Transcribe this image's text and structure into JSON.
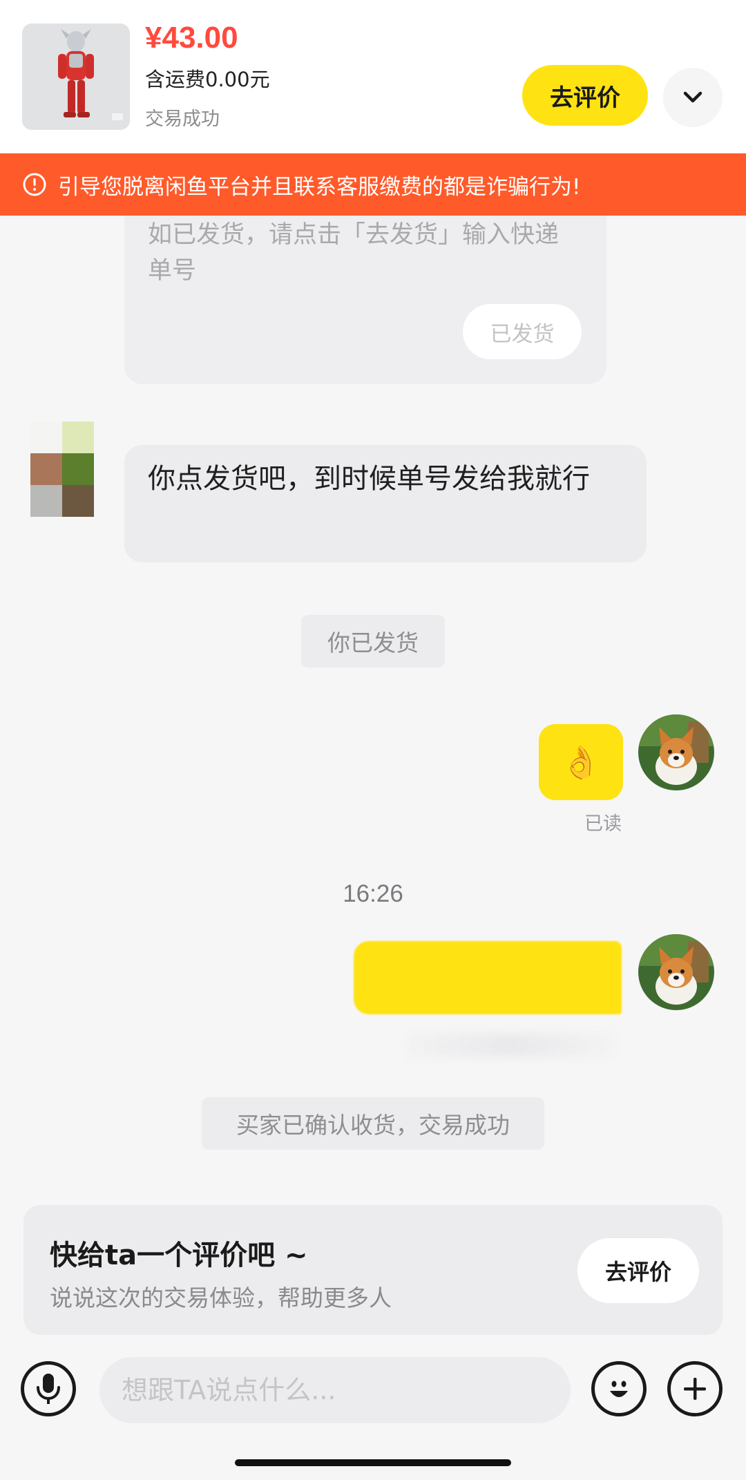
{
  "header": {
    "price": "¥43.00",
    "shipping": "含运费0.00元",
    "status": "交易成功",
    "review_button": "去评价"
  },
  "warning": {
    "text": "引导您脱离闲鱼平台并且联系客服缴费的都是诈骗行为!"
  },
  "chat": {
    "card_text": "如已发货，请点击「去发货」输入快递单号",
    "card_button": "已发货",
    "left_message": "你点发货吧，到时候单号发给我就行",
    "system_shipped": "你已发货",
    "ok_emoji": "👌",
    "read_label": "已读",
    "time": "16:26",
    "system_confirmed": "买家已确认收货，交易成功"
  },
  "review_card": {
    "title": "快给ta一个评价吧 ~",
    "subtitle": "说说这次的交易体验，帮助更多人",
    "button": "去评价"
  },
  "input_bar": {
    "placeholder": "想跟TA说点什么..."
  },
  "colors": {
    "accent_yellow": "#ffe212",
    "warning_orange": "#ff5a2a",
    "price_red": "#ff4a3d"
  },
  "icons": [
    "chevron-down-icon",
    "warning-circle-icon",
    "microphone-icon",
    "emoji-icon",
    "plus-icon"
  ]
}
